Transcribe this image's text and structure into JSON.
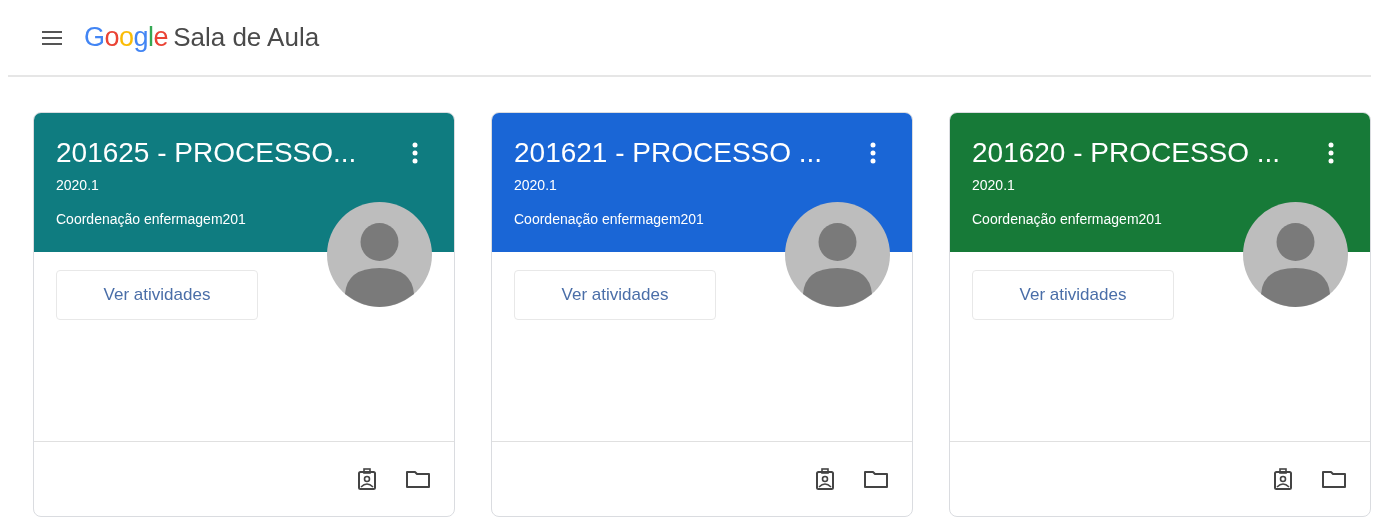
{
  "header": {
    "logo": "Google",
    "app_name": "Sala de Aula"
  },
  "classes": [
    {
      "title": "201625 - PROCESSO...",
      "section": "2020.1",
      "teacher": "Coordenação enfermagem201",
      "color": "#0f7c80",
      "action": "Ver atividades"
    },
    {
      "title": "201621 - PROCESSO ...",
      "section": "2020.1",
      "teacher": "Coordenação enfermagem201",
      "color": "#1a66d6",
      "action": "Ver atividades"
    },
    {
      "title": "201620 - PROCESSO ...",
      "section": "2020.1",
      "teacher": "Coordenação enfermagem201",
      "color": "#177a38",
      "action": "Ver atividades"
    }
  ]
}
